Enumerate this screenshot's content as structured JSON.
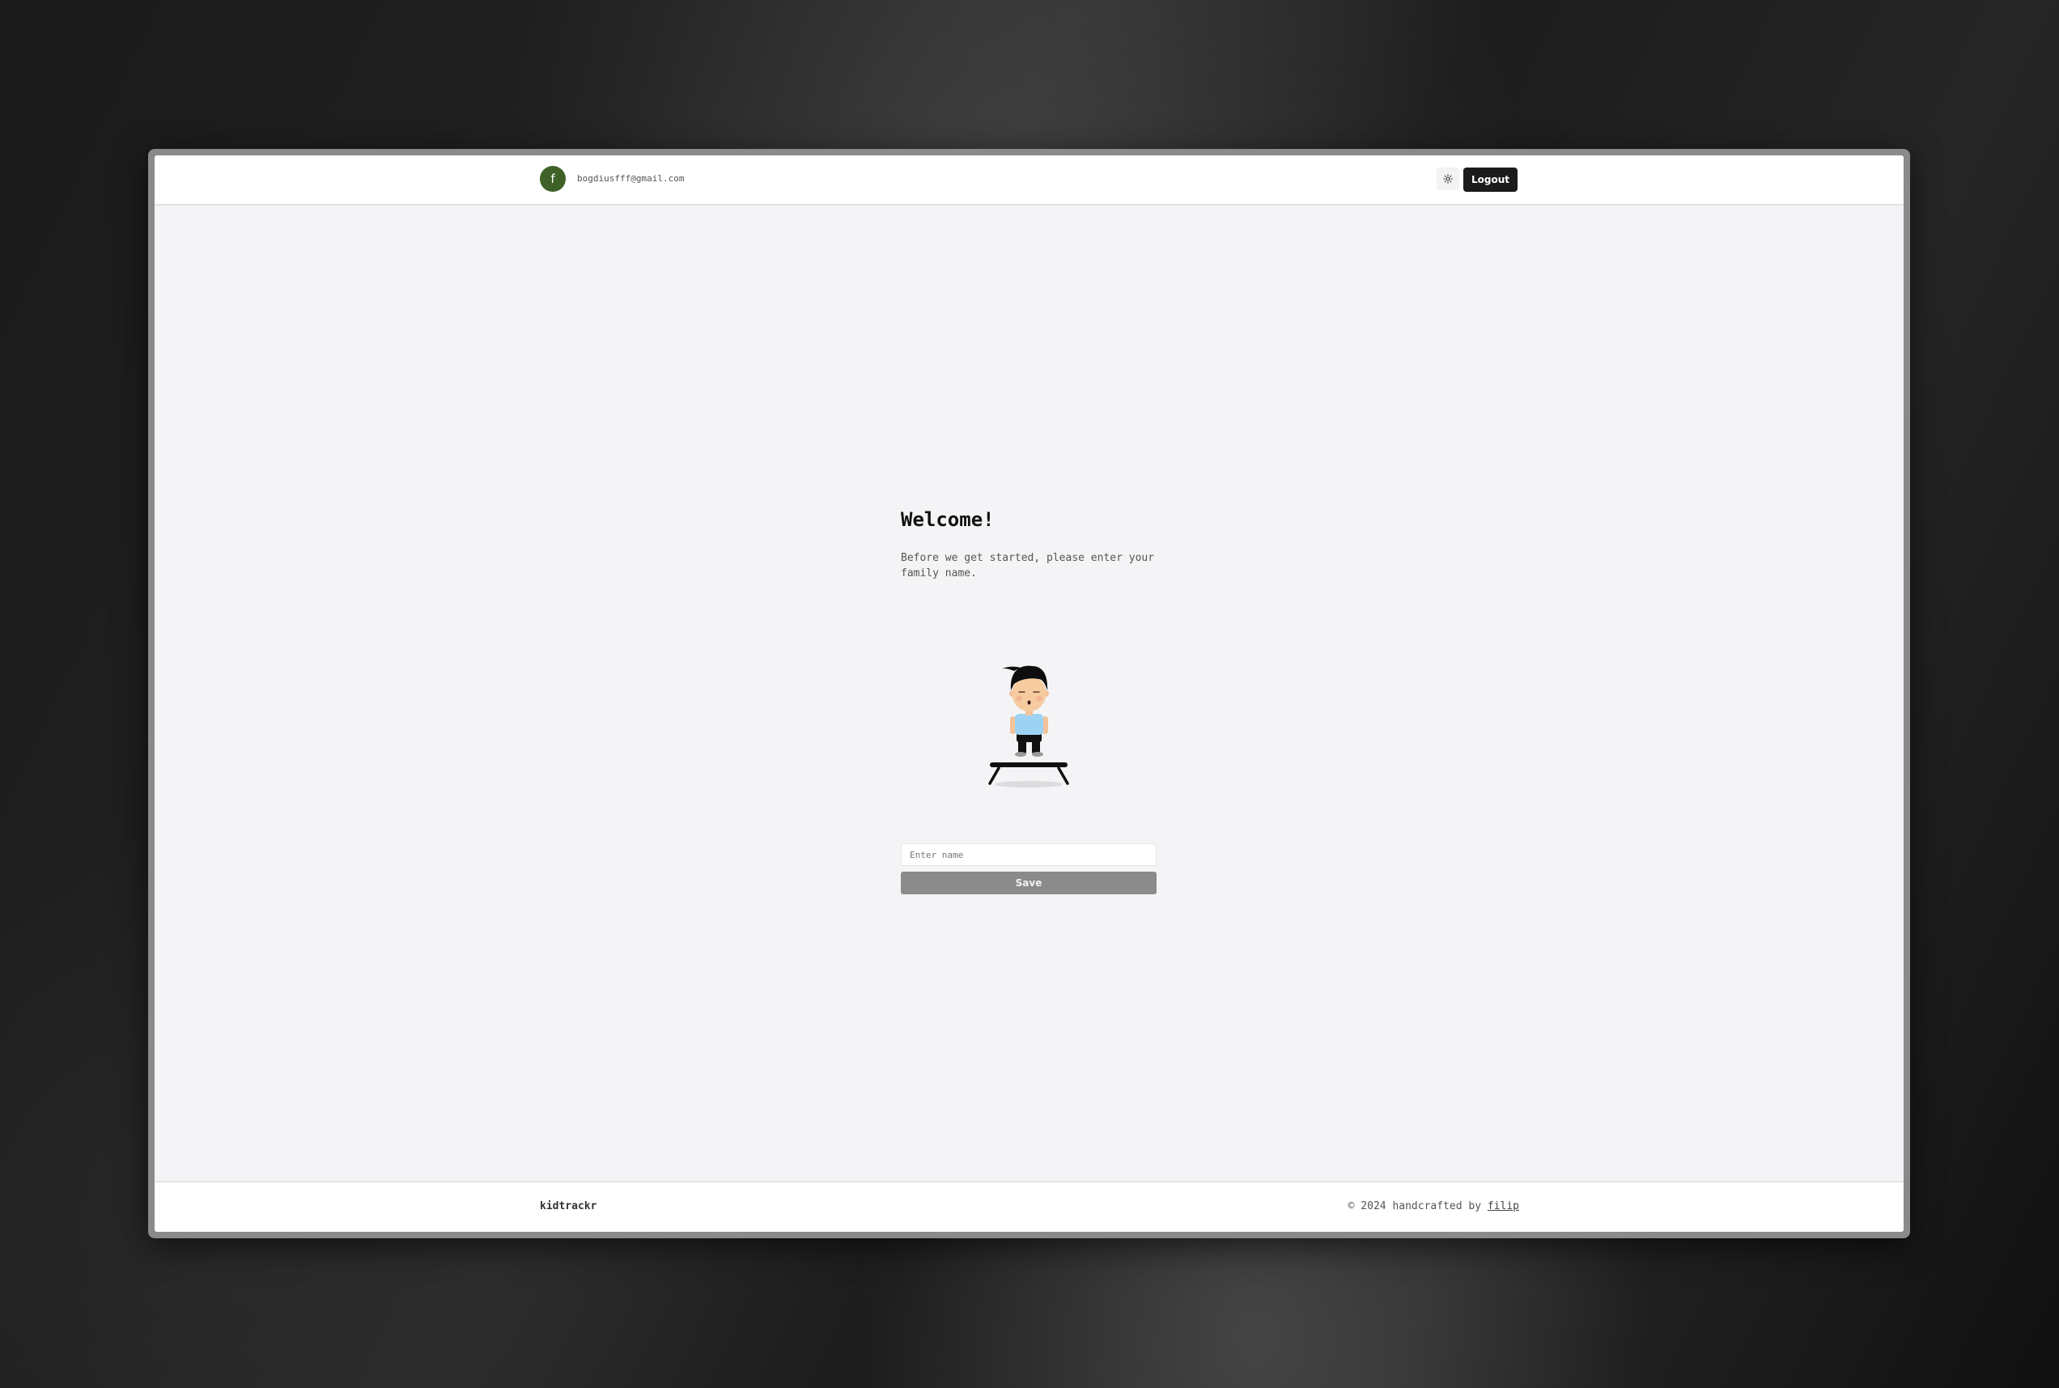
{
  "header": {
    "avatar_initial": "f",
    "user_email": "bogdiusfff@gmail.com",
    "theme_icon": "sun-icon",
    "logout_label": "Logout"
  },
  "main": {
    "title": "Welcome!",
    "subtitle": "Before we get started, please enter your family name.",
    "illustration": "kid-on-trampoline",
    "name_placeholder": "Enter name",
    "name_value": "",
    "save_label": "Save"
  },
  "footer": {
    "brand": "kidtrackr",
    "copyright_prefix": "© 2024 handcrafted by",
    "author": "filip"
  },
  "colors": {
    "avatar": "#3e6128",
    "logout_button": "#1b1b1b",
    "save_button_disabled": "#8b8b8b",
    "page_background": "#f4f4f6",
    "shirt": "#9dd3f2"
  }
}
